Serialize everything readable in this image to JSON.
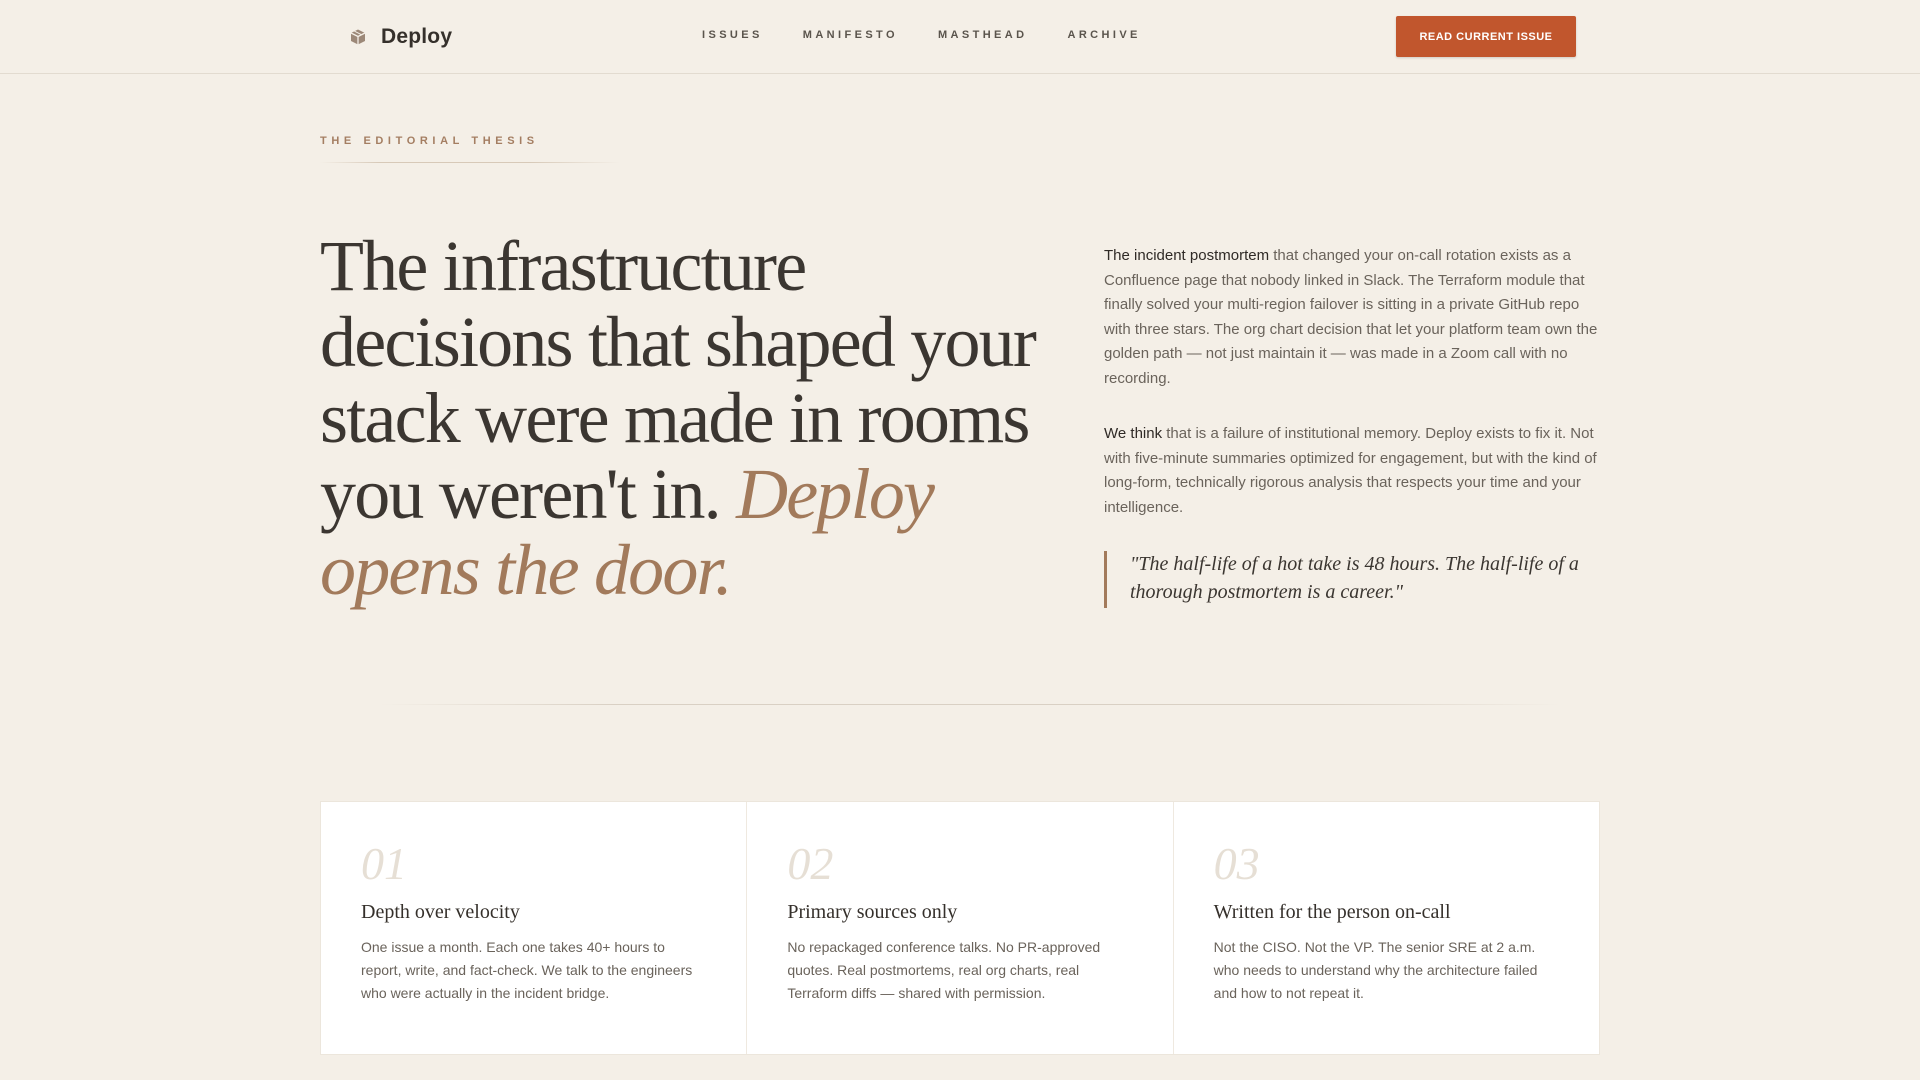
{
  "nav": {
    "brand": "Deploy",
    "brand_icon": "box-icon",
    "links": [
      "ISSUES",
      "MANIFESTO",
      "MASTHEAD",
      "ARCHIVE"
    ],
    "cta": "READ CURRENT ISSUE"
  },
  "hero": {
    "eyebrow": "THE EDITORIAL THESIS",
    "headline": "The infrastructure decisions that shaped your stack were made in rooms you weren't in.",
    "headline_accent": "Deploy opens the door."
  },
  "body": {
    "p1_lead": "The incident postmortem",
    "p1_rest": " that changed your on-call rotation exists as a Confluence page that nobody linked in Slack. The Terraform module that finally solved your multi-region failover is sitting in a private GitHub repo with three stars. The org chart decision that let your platform team own the golden path — not just maintain it — was made in a Zoom call with no recording.",
    "p2_lead": "We think",
    "p2_rest": " that is a failure of institutional memory. Deploy exists to fix it. Not with five-minute summaries optimized for engagement, but with the kind of long-form, technically rigorous analysis that respects your time and your intelligence.",
    "quote": "\"The half-life of a hot take is 48 hours. The half-life of a thorough postmortem is a career.\""
  },
  "cards": [
    {
      "num": "01",
      "title": "Depth over velocity",
      "text": "One issue a month. Each one takes 40+ hours to report, write, and fact-check. We talk to the engineers who were actually in the incident bridge."
    },
    {
      "num": "02",
      "title": "Primary sources only",
      "text": "No repackaged conference talks. No PR-approved quotes. Real postmortems, real org charts, real Terraform diffs — shared with permission."
    },
    {
      "num": "03",
      "title": "Written for the person on-call",
      "text": "Not the CISO. Not the VP. The senior SRE at 2 a.m. who needs to understand why the architecture failed and how to not repeat it."
    }
  ],
  "colors": {
    "background": "#f4efe7",
    "accent": "#c1562d",
    "accent_text": "#a27a5b",
    "ink": "#3b3631"
  }
}
